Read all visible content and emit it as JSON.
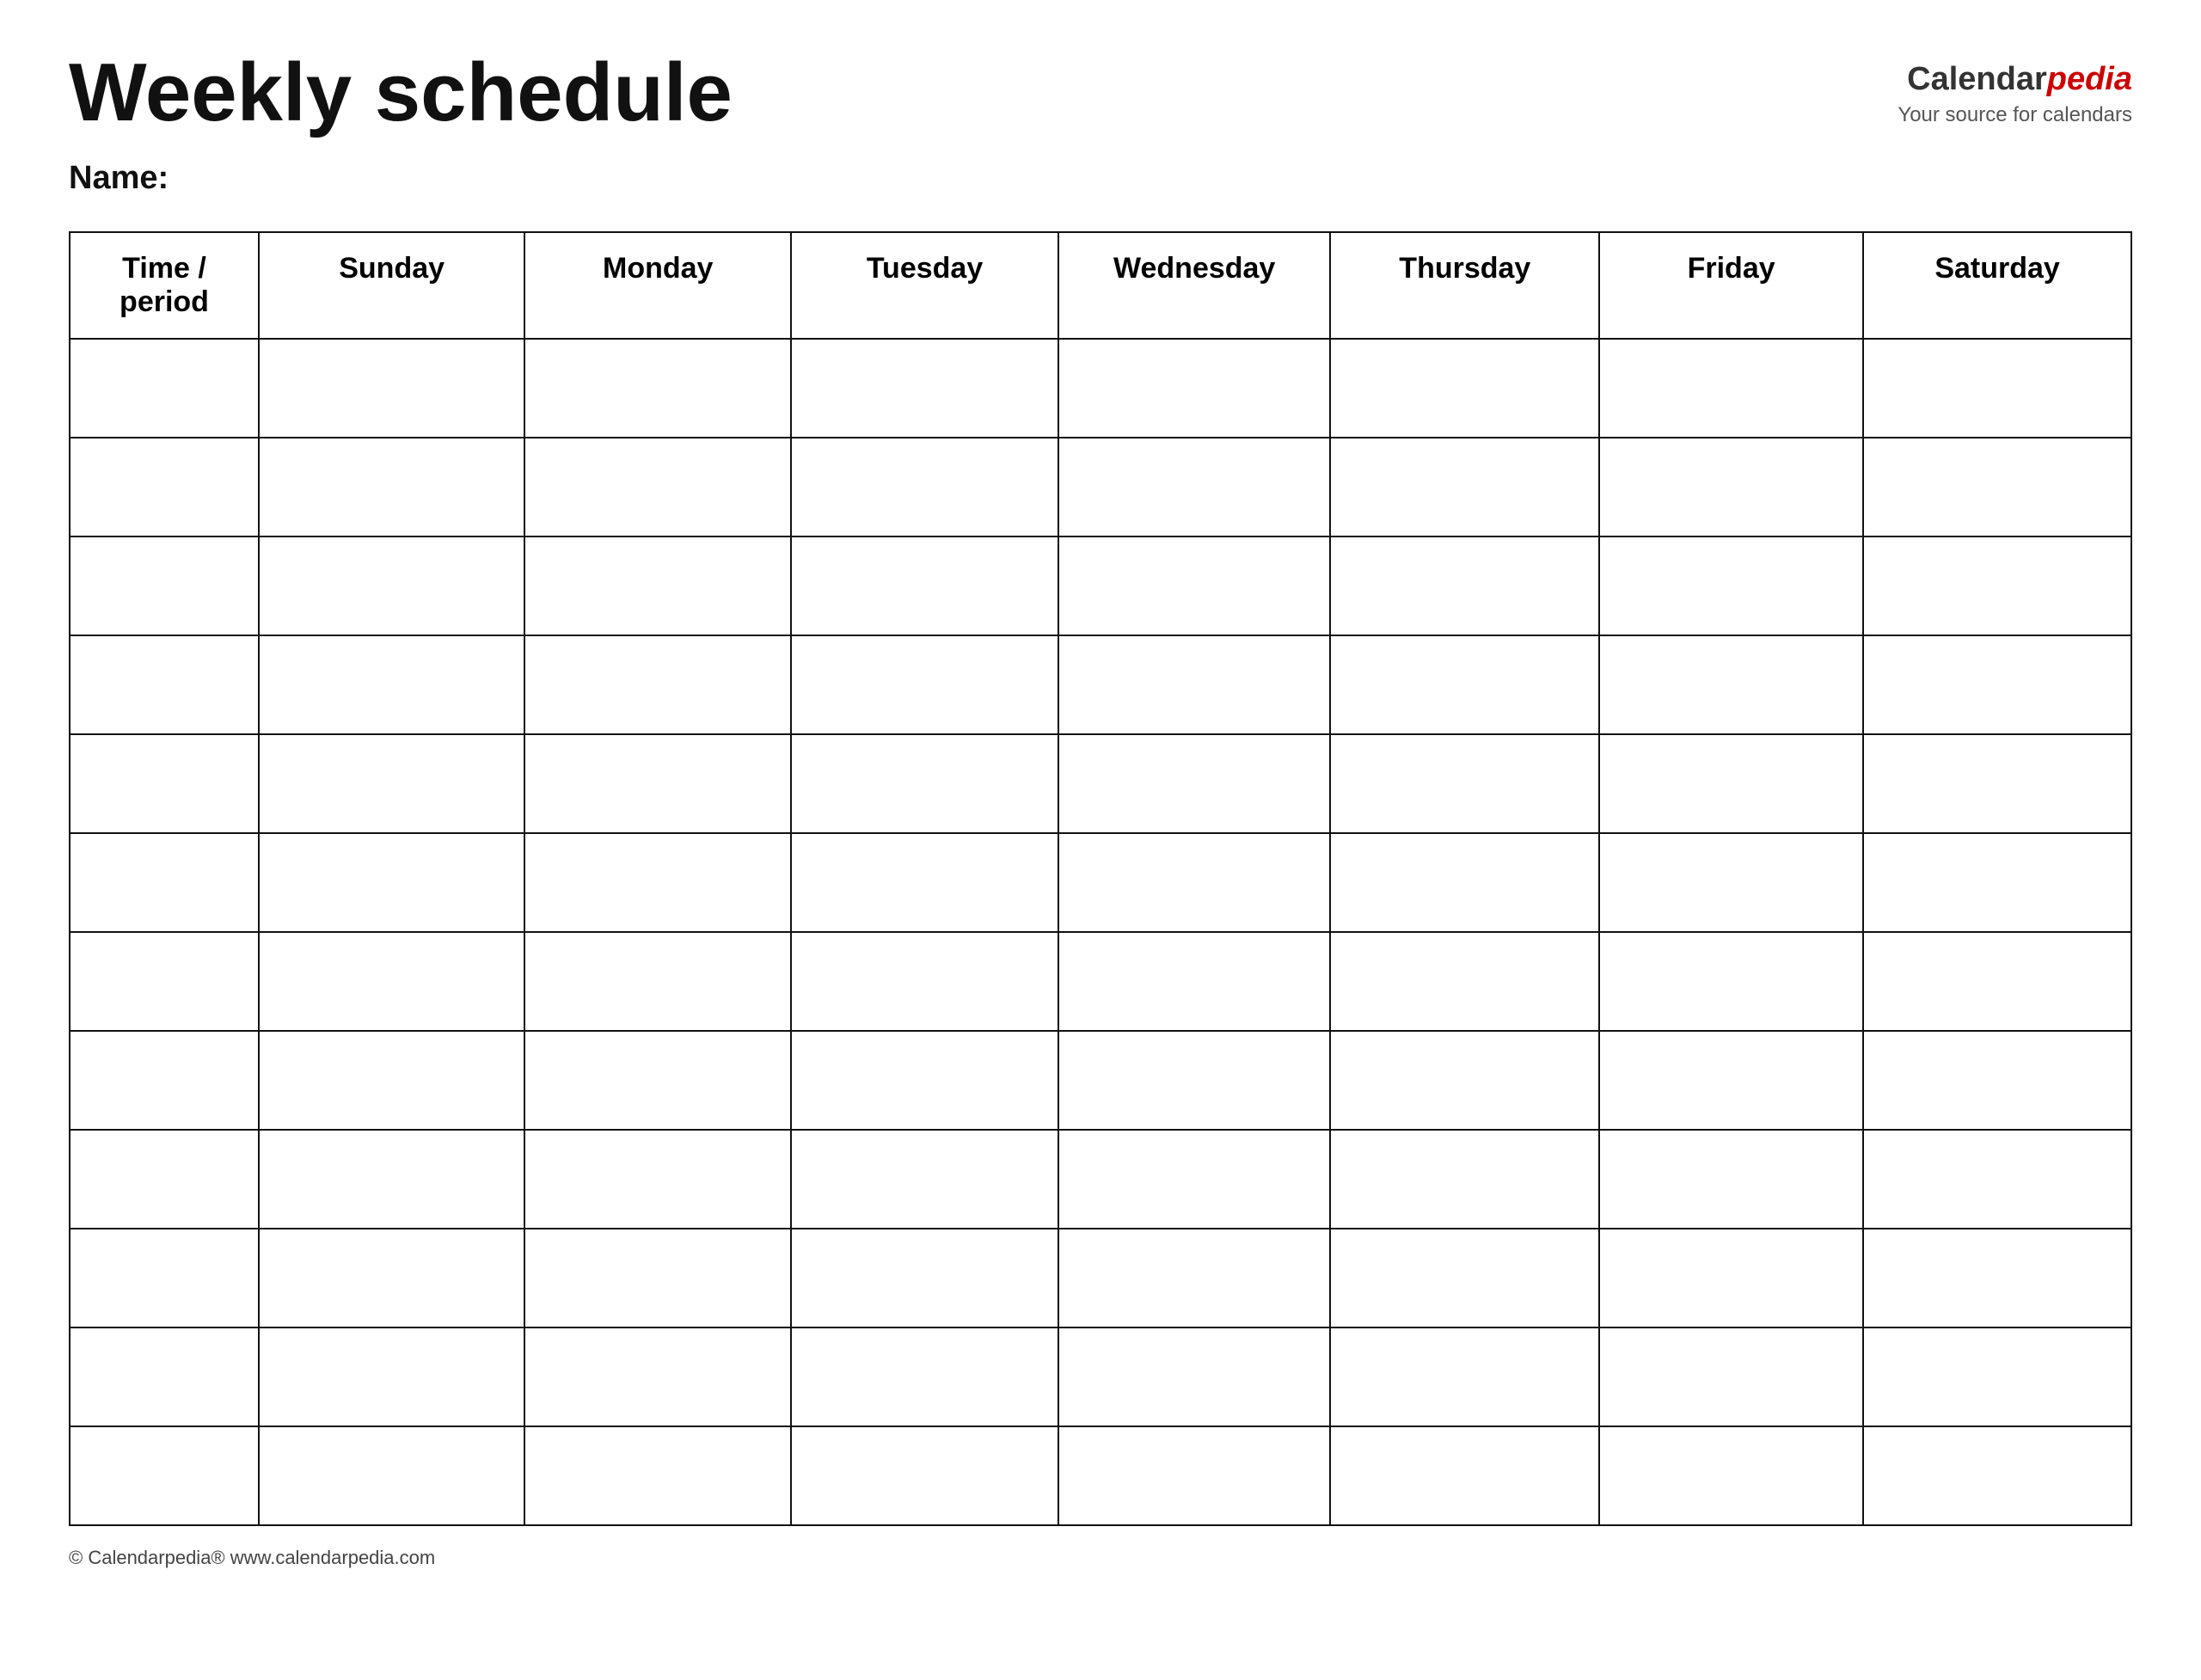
{
  "header": {
    "title": "Weekly schedule",
    "logo": {
      "calendar_text": "Calendar",
      "pedia_text": "pedia",
      "tagline": "Your source for calendars"
    }
  },
  "name_label": "Name:",
  "table": {
    "headers": [
      "Time / period",
      "Sunday",
      "Monday",
      "Tuesday",
      "Wednesday",
      "Thursday",
      "Friday",
      "Saturday"
    ],
    "rows": 12
  },
  "footer": {
    "text": "© Calendarpedia®  www.calendarpedia.com"
  }
}
